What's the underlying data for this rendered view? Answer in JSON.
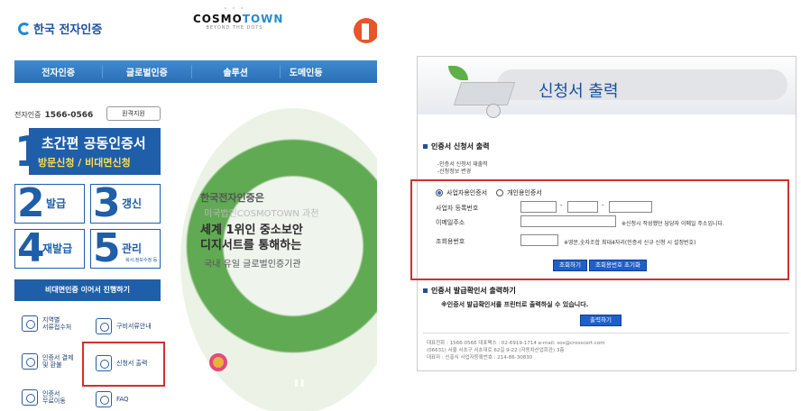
{
  "left": {
    "logo_left": "한국 전자인증",
    "logo_center": {
      "brand": "COSMO",
      "brand_accent": "TOWN",
      "sub": "BEYOND THE DOTS"
    },
    "nav": [
      "전자인증",
      "글로벌인증",
      "솔루션",
      "도메인등"
    ],
    "phone_label": "전자인증",
    "phone": "1566-0566",
    "remote": "원격지원",
    "banner_title": "초간편 공동인증서",
    "banner_sub": "방문신청 / 비대면신청",
    "tiles": [
      {
        "num": "2",
        "label": "발급",
        "extra": ""
      },
      {
        "num": "3",
        "label": "갱신",
        "extra": ""
      },
      {
        "num": "4",
        "label": "재발급",
        "extra": ""
      },
      {
        "num": "5",
        "label": "관리",
        "extra": "복사,정보수정 등"
      }
    ],
    "untact": "비대면인증 이어서 진행하기",
    "quick": [
      {
        "label": "지역별\n서류접수처"
      },
      {
        "label": "구비서류안내"
      },
      {
        "label": "인증서 결제\n및 환불"
      },
      {
        "label": "신청서 출력"
      },
      {
        "label": "인증서\n무료이동"
      },
      {
        "label": "FAQ"
      }
    ],
    "hero": {
      "ghost": "미국법인COSMOTOWN 과천",
      "line1": "세계 1위인 중소보안",
      "line2": "디지서트를 통해하는",
      "line3": "국내 유일 글로벌인증기관",
      "top": "한국전자인증은"
    }
  },
  "right": {
    "title": "신청서 출력",
    "section1": "인증서 신청서 출력",
    "desc1": "-인증서 신청서 재출력",
    "desc2": "-신청정보 변경",
    "radio1": "사업자용인증서",
    "radio2": "개인용인증서",
    "label_bizno": "사업자 등록번호",
    "label_email": "이메일주소",
    "email_note": "※신청시 작성했던 담당자 이메일 주소입니다.",
    "label_lookup": "조회용번호",
    "lookup_note": "※영문,숫자조합 최대4자리(인증서 신규 신청 시 설정번호)",
    "btn_search": "조회하기",
    "btn_reset": "조회용번호 초기화",
    "section2": "인증서 발급확인서 출력하기",
    "note2": "※인증서 발급확인서를 프린터로 출력하실 수 있습니다.",
    "btn_print": "출력하기",
    "footer1": "대표전화 : 1566-0566  대표팩스 : 02-6919-1714   e-mail: sos@crosscert.com",
    "footer2": "(06631) 서울 서초구 서초대로 62길 9-22 (자동차산업회관) 3층",
    "footer3": "대표자 : 신홍식  사업자등록번호 : 214-86-30830"
  }
}
